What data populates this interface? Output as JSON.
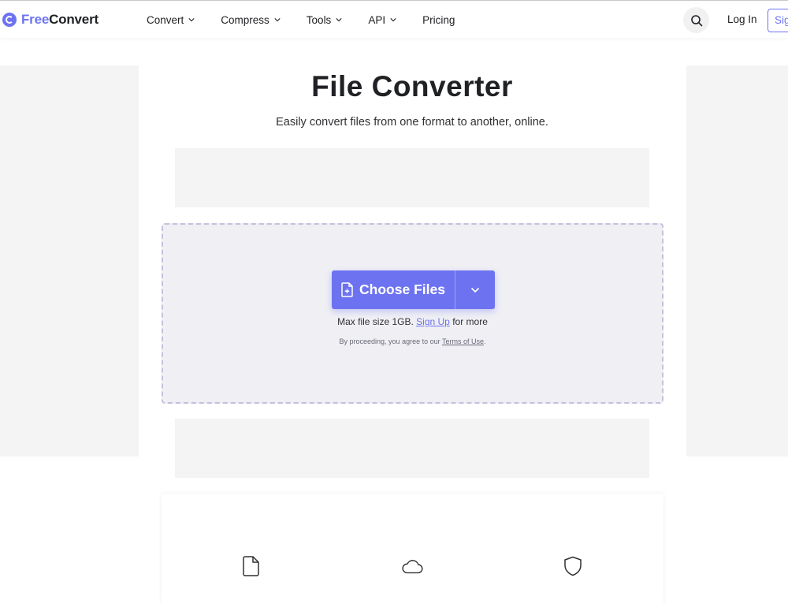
{
  "brand": {
    "name_part1": "Free",
    "name_part2": "Convert",
    "accent_color": "#6d73f0"
  },
  "nav": {
    "items": [
      {
        "label": "Convert",
        "has_dropdown": true
      },
      {
        "label": "Compress",
        "has_dropdown": true
      },
      {
        "label": "Tools",
        "has_dropdown": true
      },
      {
        "label": "API",
        "has_dropdown": true
      },
      {
        "label": "Pricing",
        "has_dropdown": false
      }
    ],
    "search_icon": "search-icon",
    "login_label": "Log In",
    "signup_label": "Sig"
  },
  "hero": {
    "title": "File Converter",
    "subtitle": "Easily convert files from one format to another, online."
  },
  "upload": {
    "button_label": "Choose Files",
    "button_icon": "file-plus-icon",
    "dropdown_icon": "chevron-down-icon",
    "max_size_prefix": "Max file size 1GB.",
    "max_size_link": "Sign Up",
    "max_size_suffix": "for more",
    "terms_prefix": "By proceeding, you agree to our",
    "terms_link": "Terms of Use",
    "terms_suffix": "."
  },
  "features": {
    "icons": [
      "file-icon",
      "cloud-icon",
      "shield-icon"
    ]
  }
}
